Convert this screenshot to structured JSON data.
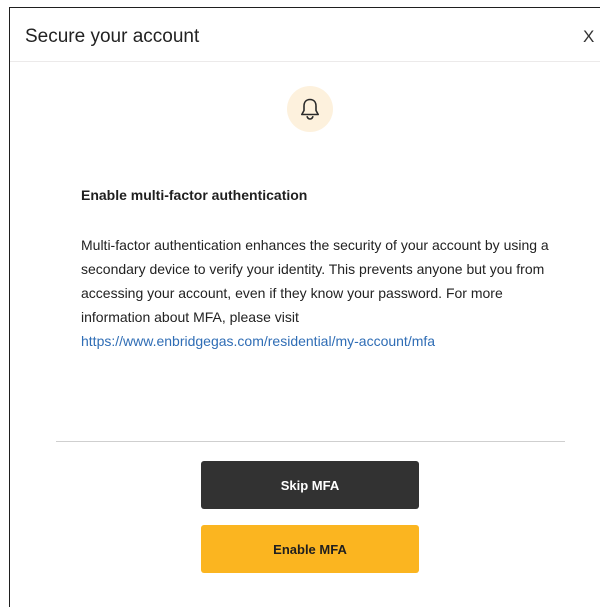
{
  "dialog": {
    "title": "Secure your account",
    "close_label": "X",
    "icon": "bell-icon",
    "icon_bg_color": "#fdf1dd",
    "heading": "Enable multi-factor authentication",
    "body_before_link": "Multi-factor authentication enhances the security of your account by using a secondary device to verify your identity. This prevents anyone but you from accessing your account, even if they know your password. For more information about MFA, please visit ",
    "link_text": "https://www.enbridgegas.com/residential/my-account/mfa",
    "link_color": "#2f6db5"
  },
  "actions": {
    "skip_label": "Skip MFA",
    "skip_color": "#323232",
    "enable_label": "Enable MFA",
    "enable_color": "#fbb520"
  }
}
